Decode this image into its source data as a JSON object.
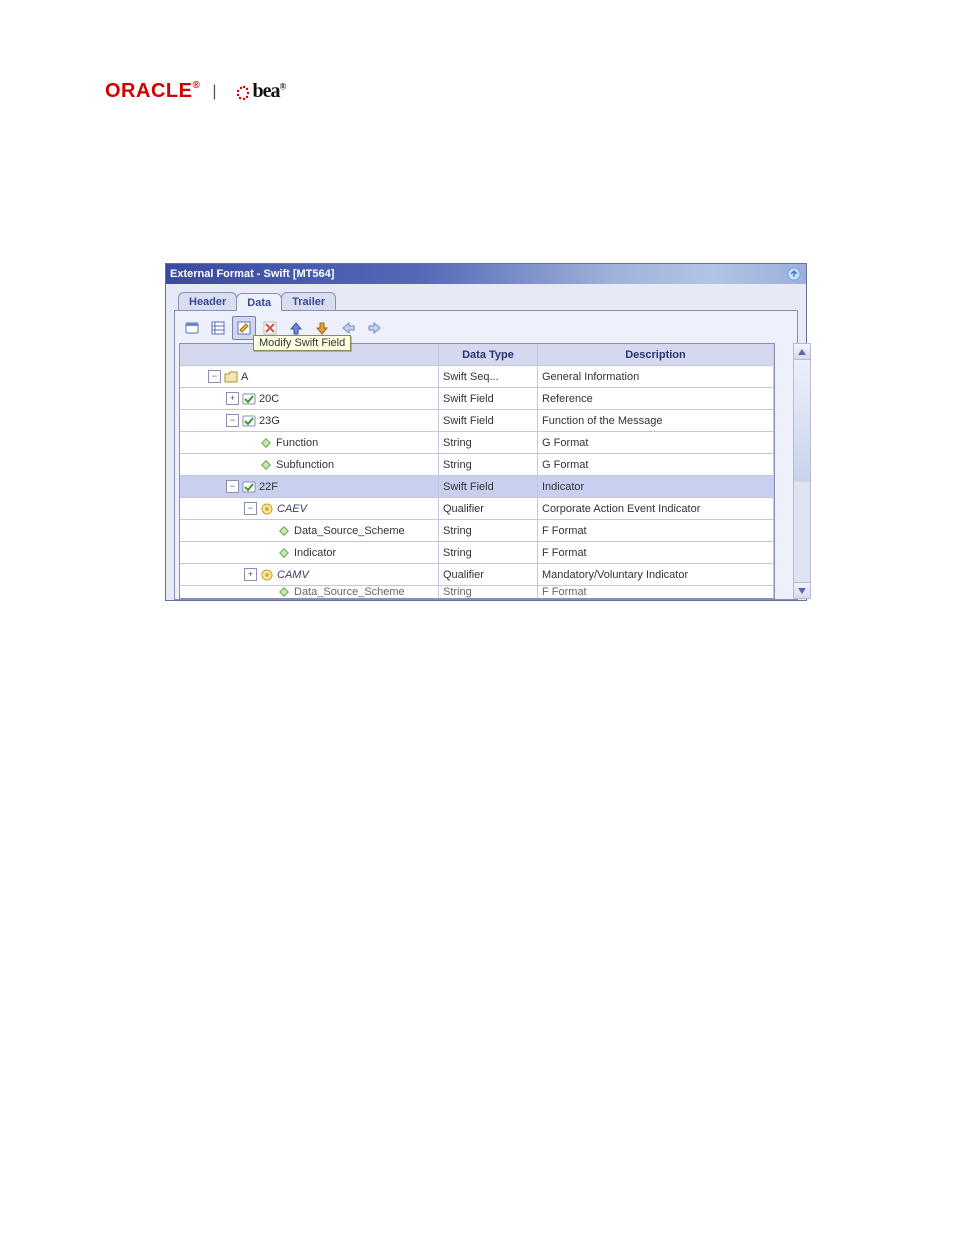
{
  "logos": {
    "oracle": "ORACLE",
    "bea": "bea"
  },
  "window": {
    "title": "External Format - Swift [MT564]"
  },
  "tabs": [
    {
      "id": "header",
      "label": "Header",
      "active": false
    },
    {
      "id": "data",
      "label": "Data",
      "active": true
    },
    {
      "id": "trailer",
      "label": "Trailer",
      "active": false
    }
  ],
  "tooltip": "Modify Swift Field",
  "grid": {
    "columns": {
      "name": "",
      "type": "Data Type",
      "desc": "Description"
    },
    "rows": [
      {
        "depth": 1,
        "expander": "-",
        "icon": "folder",
        "label": "A",
        "type": "Swift Seq...",
        "desc": "General Information",
        "selected": false,
        "italic": false
      },
      {
        "depth": 2,
        "expander": "+",
        "icon": "field-g",
        "label": "20C",
        "type": "Swift Field",
        "desc": "Reference",
        "selected": false,
        "italic": false
      },
      {
        "depth": 2,
        "expander": "-",
        "icon": "field-g",
        "label": "23G",
        "type": "Swift Field",
        "desc": "Function of the Message",
        "selected": false,
        "italic": false
      },
      {
        "depth": 3,
        "expander": "",
        "icon": "diamond",
        "label": "Function",
        "type": "String",
        "desc": "G Format",
        "selected": false,
        "italic": false
      },
      {
        "depth": 3,
        "expander": "",
        "icon": "diamond",
        "label": "Subfunction",
        "type": "String",
        "desc": "G Format",
        "selected": false,
        "italic": false
      },
      {
        "depth": 2,
        "expander": "-",
        "icon": "field-g",
        "label": "22F",
        "type": "Swift Field",
        "desc": "Indicator",
        "selected": true,
        "italic": false
      },
      {
        "depth": 3,
        "expander": "-",
        "icon": "qualifier",
        "label": "CAEV",
        "type": "Qualifier",
        "desc": "Corporate Action Event Indicator",
        "selected": false,
        "italic": true
      },
      {
        "depth": 4,
        "expander": "",
        "icon": "diamond",
        "label": "Data_Source_Scheme",
        "type": "String",
        "desc": "F Format",
        "selected": false,
        "italic": false
      },
      {
        "depth": 4,
        "expander": "",
        "icon": "diamond",
        "label": "Indicator",
        "type": "String",
        "desc": "F Format",
        "selected": false,
        "italic": false
      },
      {
        "depth": 3,
        "expander": "+",
        "icon": "qualifier",
        "label": "CAMV",
        "type": "Qualifier",
        "desc": "Mandatory/Voluntary Indicator",
        "selected": false,
        "italic": true
      }
    ],
    "partial_row": {
      "depth": 4,
      "icon": "diamond",
      "label": "Data_Source_Scheme",
      "type": "String",
      "desc": "F Format"
    }
  }
}
